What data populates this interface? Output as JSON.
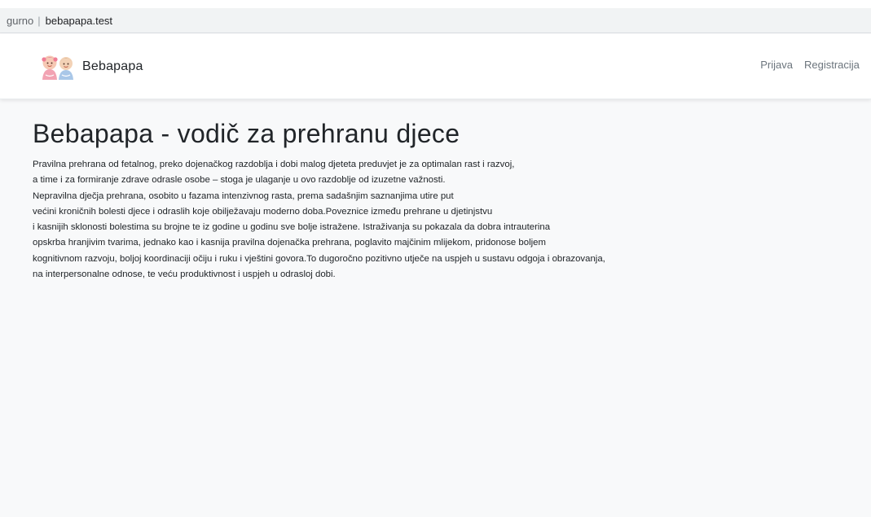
{
  "browser": {
    "security_label": "gurno",
    "separator": "|",
    "url": "bebapapa.test"
  },
  "navbar": {
    "brand_name": "Bebapapa",
    "logo_icon": "babies-logo-icon",
    "links": [
      {
        "label": "Prijava"
      },
      {
        "label": "Registracija"
      }
    ]
  },
  "main": {
    "title": "Bebapapa - vodič za prehranu djece",
    "lines": [
      "Pravilna prehrana od fetalnog, preko dojenačkog razdoblja i dobi malog djeteta preduvjet je za optimalan rast i razvoj,",
      "a time i za formiranje zdrave odrasle osobe – stoga je ulaganje u ovo razdoblje od izuzetne važnosti.",
      "Nepravilna dječja prehrana, osobito u fazama intenzivnog rasta, prema sadašnjim saznanjima utire put",
      "većini kroničnih bolesti djece i odraslih koje obilježavaju moderno doba.Poveznice između prehrane u djetinjstvu",
      "i kasnijih sklonosti bolestima su brojne te iz godine u godinu sve bolje istražene. Istraživanja su pokazala da dobra intrauterina",
      "opskrba hranjivim tvarima, jednako kao i kasnija pravilna dojenačka prehrana, poglavito majčinim mlijekom, pridonose boljem",
      "kognitivnom razvoju, boljoj koordinaciji očiju i ruku i vještini govora.To dugoročno pozitivno utječe na uspjeh u sustavu odgoja i obrazovanja,",
      "na interpersonalne odnose, te veću produktivnost i uspjeh u odrasloj dobi."
    ]
  },
  "colors": {
    "page_background": "#f8f9fa",
    "navbar_background": "#ffffff",
    "text": "#212529",
    "nav_link": "#6c757d"
  }
}
